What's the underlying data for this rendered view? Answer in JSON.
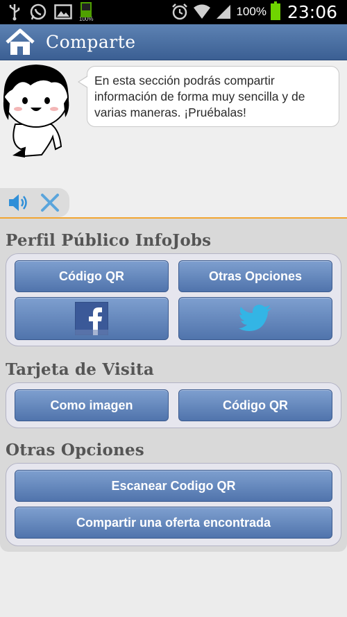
{
  "status_bar": {
    "battery_percent": "100%",
    "small_battery_label": "100%",
    "time": "23:06",
    "icons": [
      "usb-icon",
      "whatsapp-icon",
      "gallery-icon",
      "battery-full-icon",
      "alarm-icon",
      "wifi-icon",
      "signal-icon",
      "battery-icon"
    ]
  },
  "action_bar": {
    "title": "Comparte",
    "home_icon": "home-icon"
  },
  "intro": {
    "message": "En esta sección podrás compartir información de forma muy sencilla y de varias maneras. ¡Pruébalas!",
    "audio_icon": "speaker-icon",
    "close_icon": "close-icon"
  },
  "sections": {
    "perfil": {
      "title": "Perfil Público InfoJobs",
      "qr_label": "Código QR",
      "other_label": "Otras Opciones",
      "facebook_icon": "facebook-icon",
      "twitter_icon": "twitter-icon"
    },
    "tarjeta": {
      "title": "Tarjeta de Visita",
      "image_label": "Como imagen",
      "qr_label": "Código QR"
    },
    "otras": {
      "title": "Otras Opciones",
      "scan_label": "Escanear Codigo QR",
      "share_label": "Compartir una oferta encontrada"
    }
  },
  "colors": {
    "action_bar": "#4a6fa3",
    "button_top": "#7e9fcf",
    "button_bottom": "#5074ac",
    "accent_line": "#f2a531",
    "facebook": "#3b5998",
    "twitter": "#33b5e5"
  }
}
